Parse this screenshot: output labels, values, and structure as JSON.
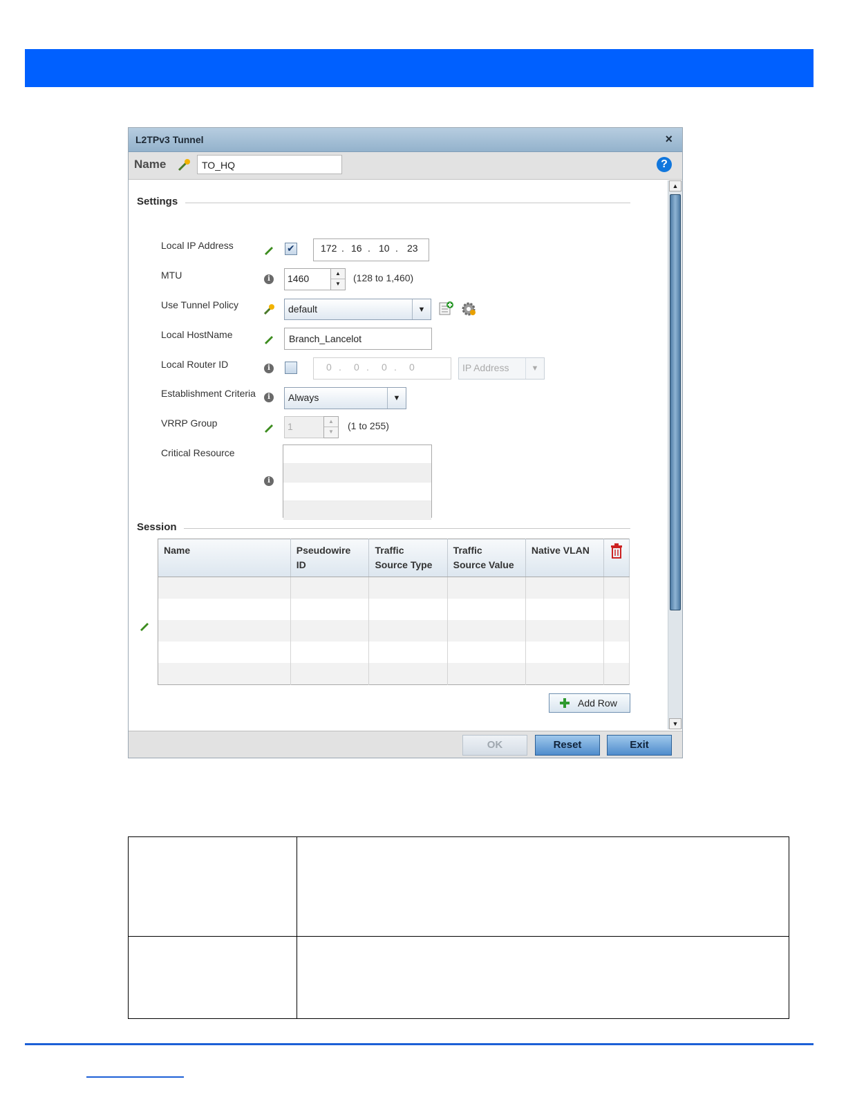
{
  "dialog": {
    "title": "L2TPv3 Tunnel",
    "close_label": "×",
    "name_label": "Name",
    "name_value": "TO_HQ",
    "help_label": "?"
  },
  "settings": {
    "heading": "Settings",
    "local_ip": {
      "label": "Local IP Address",
      "checked": true,
      "octets": [
        "172",
        "16",
        "10",
        "23"
      ]
    },
    "mtu": {
      "label": "MTU",
      "value": "1460",
      "range": "(128 to 1,460)"
    },
    "tunnel_policy": {
      "label": "Use Tunnel Policy",
      "value": "default"
    },
    "local_hostname": {
      "label": "Local HostName",
      "value": "Branch_Lancelot"
    },
    "local_router_id": {
      "label": "Local Router ID",
      "checked": false,
      "octets": [
        "0",
        "0",
        "0",
        "0"
      ],
      "type_value": "IP Address"
    },
    "establishment": {
      "label": "Establishment Criteria",
      "value": "Always"
    },
    "vrrp_group": {
      "label": "VRRP Group",
      "value": "1",
      "range": "(1 to 255)"
    },
    "critical_resource": {
      "label": "Critical Resource"
    }
  },
  "session": {
    "heading": "Session",
    "columns": [
      {
        "line1": "Name",
        "line2": ""
      },
      {
        "line1": "Pseudowire",
        "line2": "ID"
      },
      {
        "line1": "Traffic",
        "line2": "Source Type"
      },
      {
        "line1": "Traffic",
        "line2": "Source Value"
      },
      {
        "line1": "Native VLAN",
        "line2": ""
      }
    ],
    "add_row_label": "Add Row"
  },
  "buttons": {
    "ok": "OK",
    "reset": "Reset",
    "exit": "Exit"
  },
  "colors": {
    "banner": "#0060ff",
    "accent": "#1177dd",
    "delete": "#cc2222",
    "edit": "#3c8c1e"
  }
}
